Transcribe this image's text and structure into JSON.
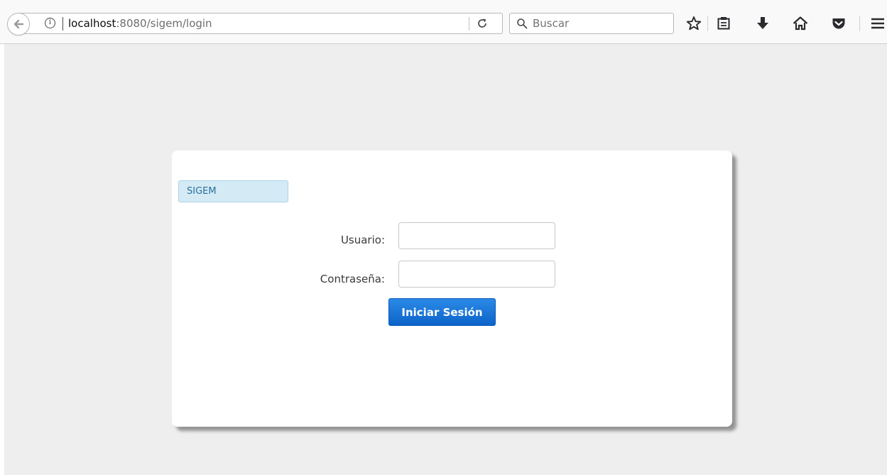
{
  "browser": {
    "url_host": "localhost",
    "url_rest": ":8080/sigem/login",
    "search_placeholder": "Buscar",
    "icons": [
      "back-arrow-icon",
      "info-icon",
      "reload-icon",
      "search-icon",
      "bookmark-star-icon",
      "reading-list-icon",
      "download-icon",
      "home-icon",
      "pocket-icon",
      "hamburger-menu-icon"
    ]
  },
  "login": {
    "app_name": "SIGEM",
    "username_label": "Usuario:",
    "username_value": "",
    "password_label": "Contraseña:",
    "password_value": "",
    "submit_label": "Iniciar Sesión"
  },
  "colors": {
    "page_background": "#eeeeee",
    "badge_background": "#d4ebf6",
    "badge_text": "#2a6f9c",
    "button_blue": "#1272d6"
  }
}
